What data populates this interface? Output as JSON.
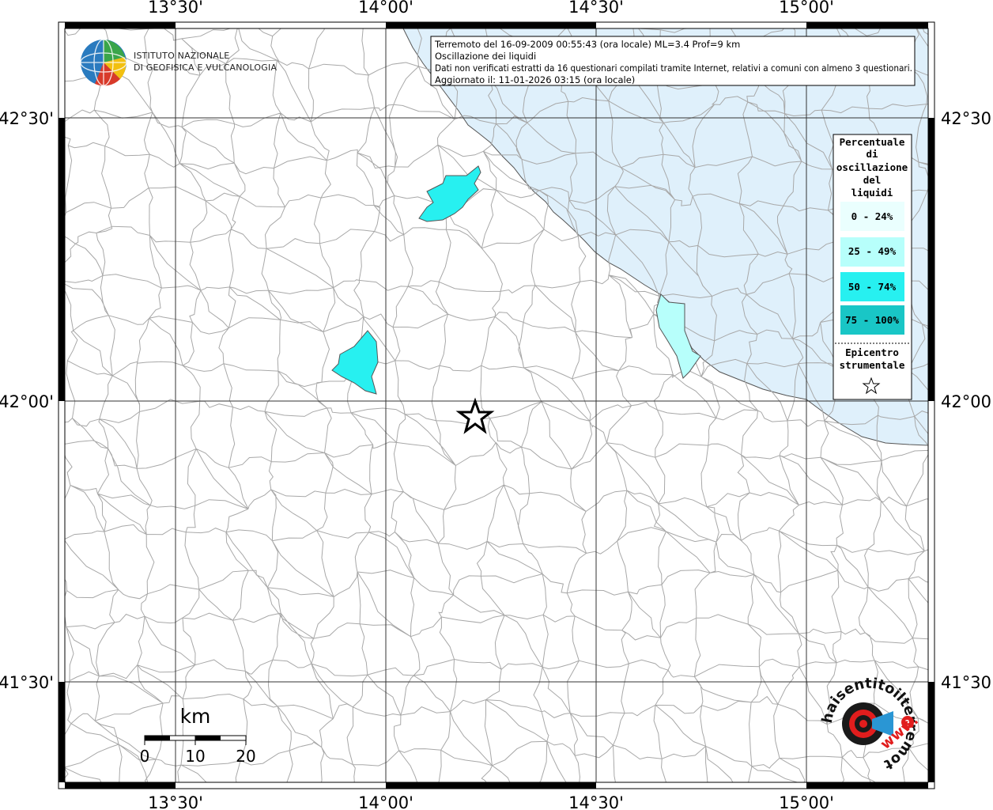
{
  "info_box": {
    "line1": "Terremoto del 16-09-2009 00:55:43 (ora locale) ML=3.4 Prof=9 km",
    "line2": "Oscillazione dei liquidi",
    "line3": "Dati non verificati estratti da 16 questionari compilati tramite Internet, relativi a comuni con almeno 3 questionari.",
    "line4": "Aggiornato il: 11-01-2026 03:15 (ora locale)"
  },
  "logo": {
    "line1": "ISTITUTO NAZIONALE",
    "line2": "DI GEOFISICA E VULCANOLOGIA"
  },
  "coords": {
    "lon": [
      "13°30'",
      "14°00'",
      "14°30'",
      "15°00'"
    ],
    "lat": [
      "42°30'",
      "42°00'",
      "41°30'"
    ]
  },
  "legend": {
    "title": [
      "Percentuale",
      "di",
      "oscillazione",
      "del",
      "liquidi"
    ],
    "classes": [
      {
        "label": "0 - 24%",
        "color": "#eafffe"
      },
      {
        "label": "25 - 49%",
        "color": "#b7fffb"
      },
      {
        "label": "50 - 74%",
        "color": "#27f0f0"
      },
      {
        "label": "75 - 100%",
        "color": "#19c6c6"
      }
    ],
    "epicenter_title": [
      "Epicentro",
      "strumentale"
    ],
    "epicenter_icon": "star-icon"
  },
  "scalebar": {
    "unit": "km",
    "ticks": [
      "0",
      "10",
      "20"
    ]
  },
  "haisentito": {
    "text": "haisentitoilterremoto.it",
    "text_colored": "www."
  },
  "colors": {
    "sea": "#dff0fb",
    "land": "#ffffff",
    "boundary": "#a8a8a8",
    "grid": "#333333",
    "cls_50_74": "#27f0f0",
    "cls_25_49": "#b7fffb"
  }
}
